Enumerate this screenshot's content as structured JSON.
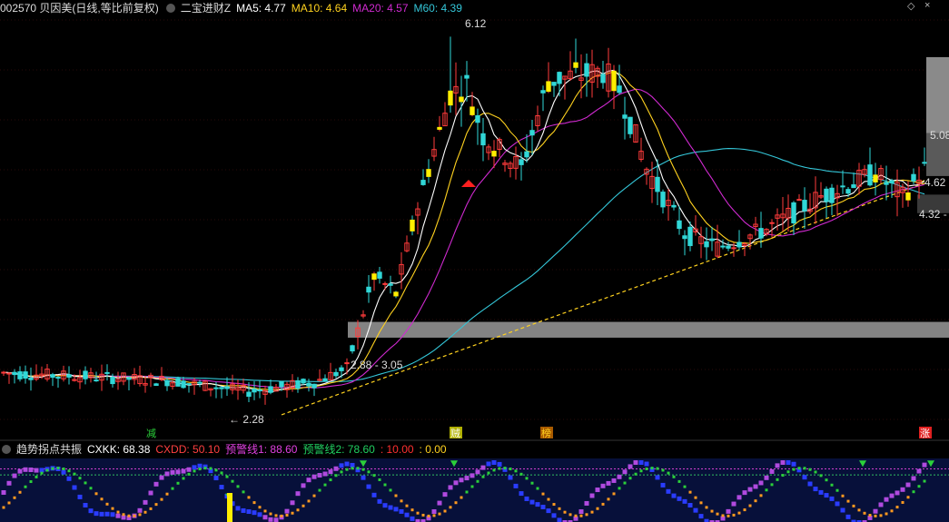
{
  "header": {
    "code_name": "002570 贝因美(日线,等比前复权)",
    "indicator_name": "二宝进财Z",
    "ma5": "MA5: 4.77",
    "ma10": "MA10: 4.64",
    "ma20": "MA20: 4.57",
    "m60": "M60: 4.39"
  },
  "sub_header": {
    "name": "趋势拐点共振",
    "cxkk": "CXKK: 68.38",
    "cxdd": "CXDD: 50.10",
    "warn1": "预警线1: 88.60",
    "warn2": "预警线2: 78.60",
    "v1": ": 10.00",
    "v2": ": 0.00"
  },
  "colors": {
    "up": "#ff3b3b",
    "down": "#31d7d7",
    "ma5": "#ffffff",
    "ma10": "#ffd21f",
    "ma20": "#d02ad0",
    "m60": "#34c6d8",
    "trend": "#ffd21f",
    "signal": "#ffee00",
    "band": "#9a9a9a",
    "sub_bg": "#07103a"
  },
  "chart_data": [
    {
      "type": "candlestick",
      "y_range": [
        2.0,
        6.3
      ],
      "annotations": {
        "peak": "6.12",
        "low": "2.28",
        "band_range": "2.88 - 3.05",
        "right_high": "5.08",
        "right_price": "4.62",
        "right_low": "4.32"
      },
      "markers": [
        "减",
        "贼",
        "榜",
        "涨"
      ],
      "ma_labels": [
        "MA5",
        "MA10",
        "MA20",
        "M60"
      ]
    },
    {
      "type": "indicator",
      "name": "趋势拐点共振",
      "y_range": [
        0,
        100
      ],
      "cxkk": 68.38,
      "cxdd": 50.1,
      "warn1": 88.6,
      "warn2": 78.6
    }
  ]
}
